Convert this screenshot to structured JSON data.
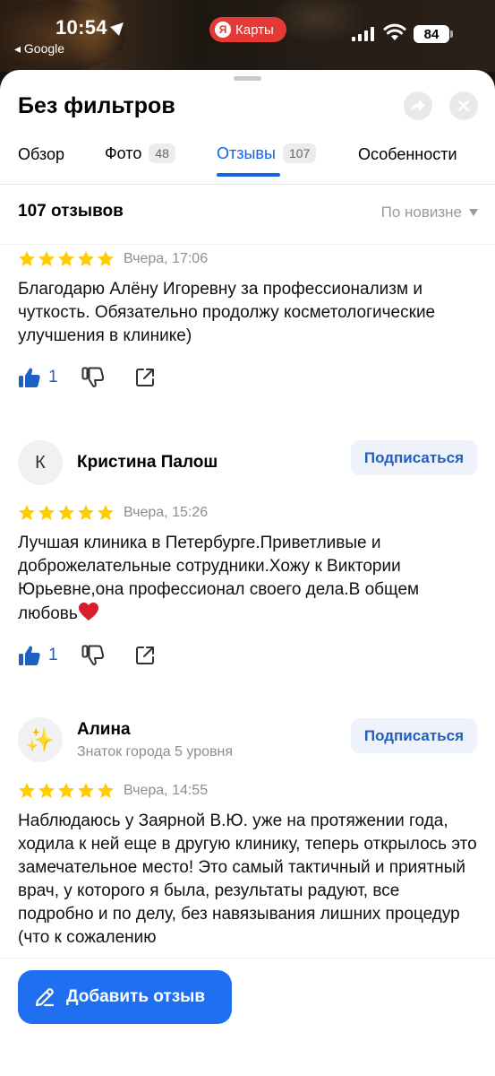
{
  "status": {
    "time": "10:54",
    "back_app": "◂ Google",
    "app_pill": "Карты",
    "app_pill_logo": "Я",
    "battery": "84"
  },
  "header": {
    "title": "Без фильтров",
    "share_icon": "share-arrow-icon",
    "close_icon": "close-icon"
  },
  "tabs": [
    {
      "label": "Обзор"
    },
    {
      "label": "Фото",
      "count": "48"
    },
    {
      "label": "Отзывы",
      "count": "107",
      "active": true
    },
    {
      "label": "Особенности"
    }
  ],
  "reviews_header": {
    "count": "107 отзывов",
    "sort": "По новизне"
  },
  "reviews": [
    {
      "stars": 5,
      "date": "Вчера, 17:06",
      "text": "Благодарю Алёну Игоревну за профессионализм и чуткость. Обязательно продолжу косметологические улучшения в клинике)",
      "likes": "1"
    },
    {
      "author": "Кристина Палош",
      "avatar_letter": "К",
      "subscribe": "Подписаться",
      "stars": 5,
      "date": "Вчера, 15:26",
      "text": "Лучшая клиника в Петербурге.Приветливые и доброжелательные сотрудники.Хожу к Виктории Юрьевне,она профессионал своего дела.В общем любовь",
      "likes": "1"
    },
    {
      "author": "Алина",
      "author_level": "Знаток города 5 уровня",
      "avatar_emoji": "✨",
      "subscribe": "Подписаться",
      "stars": 5,
      "date": "Вчера, 14:55",
      "text": "Наблюдаюсь у Заярной В.Ю. уже на протяжении года, ходила к ней еще в другую клинику, теперь открылось это замечательное место! Это самый тактичный и приятный врач, у которого я была, результаты радуют, все подробно и по делу, без навязывания лишних процедур (что к сожалению"
    }
  ],
  "footer": {
    "add_review": "Добавить отзыв"
  },
  "colors": {
    "accent": "#1f6ff0",
    "star": "#ffcc00",
    "maps_red": "#e53935"
  }
}
